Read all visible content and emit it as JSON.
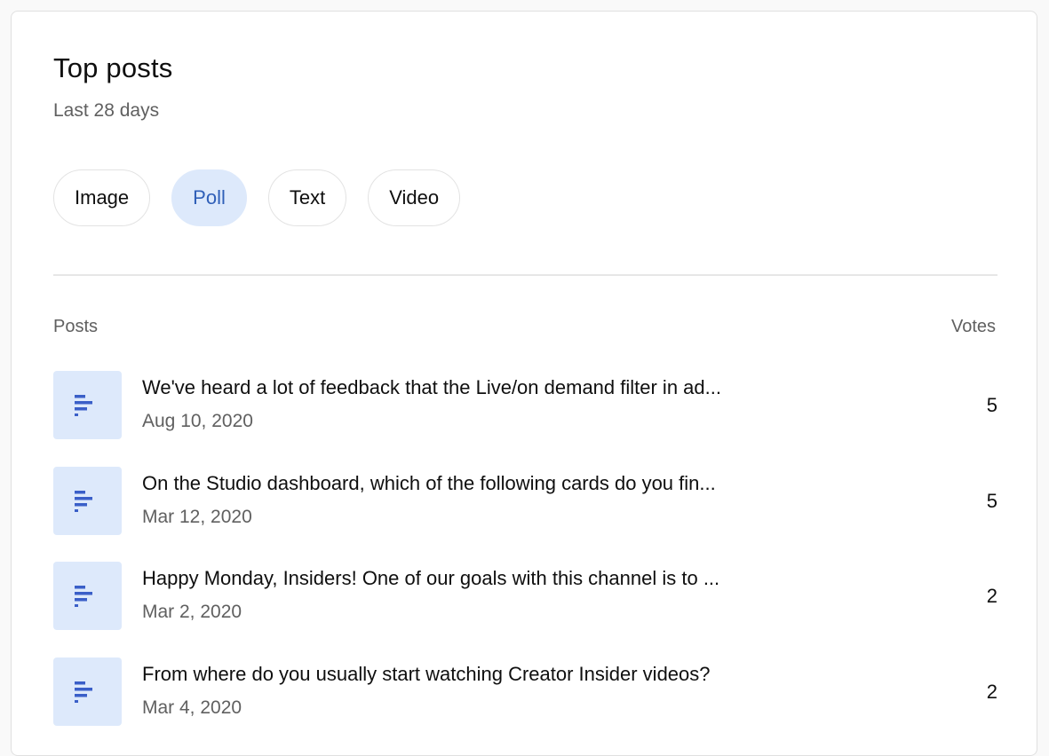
{
  "card": {
    "title": "Top posts",
    "subtitle": "Last 28 days"
  },
  "filters": [
    {
      "label": "Image",
      "selected": false
    },
    {
      "label": "Poll",
      "selected": true
    },
    {
      "label": "Text",
      "selected": false
    },
    {
      "label": "Video",
      "selected": false
    }
  ],
  "table": {
    "posts_header": "Posts",
    "votes_header": "Votes",
    "rows": [
      {
        "title": "We've heard a lot of feedback that the Live/on demand filter in ad...",
        "date": "Aug 10, 2020",
        "votes": "5",
        "icon": "poll-icon"
      },
      {
        "title": "On the Studio dashboard, which of the following cards do you fin...",
        "date": "Mar 12, 2020",
        "votes": "5",
        "icon": "poll-icon"
      },
      {
        "title": "Happy Monday, Insiders! One of our goals with this channel is to ...",
        "date": "Mar 2, 2020",
        "votes": "2",
        "icon": "poll-icon"
      },
      {
        "title": "From where do you usually start watching Creator Insider videos?",
        "date": "Mar 4, 2020",
        "votes": "2",
        "icon": "poll-icon"
      }
    ]
  },
  "colors": {
    "accent": "#2f5fb8",
    "chip_selected_bg": "#dde9fb",
    "icon_color": "#3a5fc8"
  }
}
